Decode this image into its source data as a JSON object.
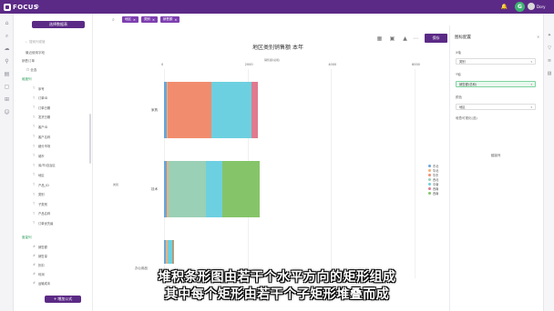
{
  "app": {
    "logo": "FOCUS",
    "user": "Dory",
    "avatar_letter": "G"
  },
  "sidebar": {
    "new_button": "选择数据表",
    "search_placeholder": "搜索列或值",
    "recent_label": "最近使用字段",
    "group_label": "销售订单",
    "all_label": "全选",
    "dim_label": "维度列",
    "measure_label": "度量列",
    "add_formula": "+ 增加公式",
    "dimensions": [
      "序号",
      "订单ID",
      "订单日期",
      "发货日期",
      "客户ID",
      "客户名称",
      "细分市场",
      "城市",
      "省/市/自治区",
      "地区",
      "产品_ID",
      "类别",
      "子类别",
      "产品名称",
      "订单优先级"
    ],
    "measures": [
      "销售额",
      "销售量",
      "折扣",
      "利润",
      "运输成本"
    ]
  },
  "search_chips": [
    "地区",
    "类别",
    "销售额"
  ],
  "chart": {
    "toolbar_run": "保存"
  },
  "panel": {
    "title": "图标配置",
    "x_label": "X轴",
    "x_value": "类别",
    "y_label": "Y轴",
    "y_value": "销售额(总和)",
    "color_label": "颜色",
    "color_value": "地区",
    "size_label": "堆叠可视化(选)",
    "link": "链接列"
  },
  "subtitle": {
    "line1": "堆积条形图由若干个水平方向的矩形组成",
    "line2": "其中每个矩形由若干个子矩形堆叠而成"
  },
  "chart_data": {
    "type": "bar",
    "orientation": "horizontal",
    "stacked": true,
    "title": "地区类别销售额 本年",
    "xlabel": "销售额(总和)",
    "ylabel": "类别",
    "xlim": [
      0,
      6000
    ],
    "x_ticks": [
      "0",
      "2000",
      "4000",
      "6000"
    ],
    "categories": [
      "家具",
      "技术",
      "办公用品"
    ],
    "series": [
      {
        "name": "东北",
        "color": "#6aa6d8",
        "values": [
          60,
          60,
          50
        ]
      },
      {
        "name": "华北",
        "color": "#f2b27a",
        "values": [
          30,
          40,
          30
        ]
      },
      {
        "name": "华东",
        "color": "#f28c6e",
        "values": [
          1050,
          0,
          0
        ]
      },
      {
        "name": "西北",
        "color": "#9ad0b6",
        "values": [
          0,
          900,
          0
        ]
      },
      {
        "name": "中南",
        "color": "#6dd0e0",
        "values": [
          950,
          400,
          120
        ]
      },
      {
        "name": "西南",
        "color": "#e07a8e",
        "values": [
          150,
          0,
          10
        ]
      },
      {
        "name": "西南",
        "color": "#86c46a",
        "values": [
          0,
          900,
          30
        ]
      }
    ],
    "legend": [
      "东北",
      "华北",
      "华东",
      "中南",
      "西北",
      "西南",
      "西南"
    ],
    "legend_position": "right"
  },
  "colors": {
    "brand": "#5b2a86",
    "chip": "#7d3fb0",
    "accent_green": "#2e9d5a"
  }
}
